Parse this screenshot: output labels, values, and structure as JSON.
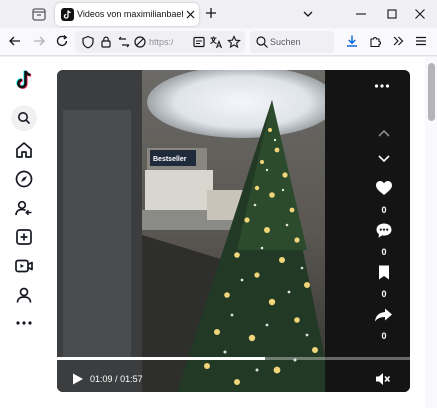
{
  "browser": {
    "tab_title": "Videos von maximilianbaehring",
    "url_prefix": "https://w",
    "search_placeholder": "Suchen"
  },
  "player": {
    "current_time": "01:09",
    "separator": "/",
    "duration": "01:57",
    "progress": 0.59,
    "likes": "0",
    "comments": "0",
    "saves": "0",
    "shares": "0"
  },
  "colors": {
    "accent_blue": "#0061e0",
    "tiktok_black": "#111111"
  },
  "sidebar": {
    "icons": [
      "tiktok-logo",
      "search-icon",
      "home-icon",
      "explore-icon",
      "following-icon",
      "upload-icon",
      "live-icon",
      "profile-icon",
      "more-icon"
    ]
  }
}
